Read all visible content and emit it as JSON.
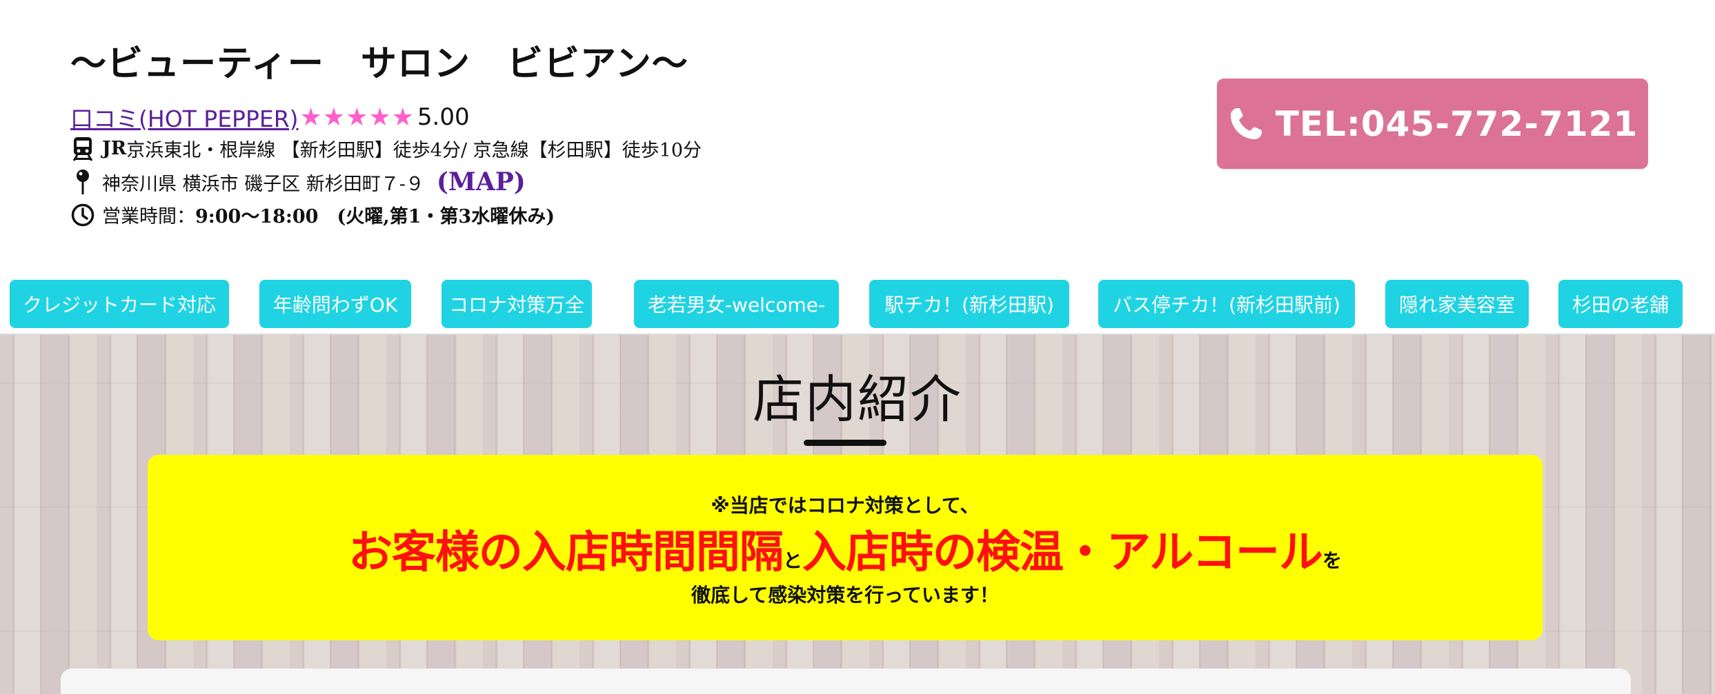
{
  "header": {
    "shop_title": "〜ビューティー　サロン　ビビアン〜",
    "reviews_link": "口コミ(HOT PEPPER)",
    "rating_stars": "★★★★★",
    "rating_score": "5.00",
    "access_prefix": "JR",
    "access_text": " 京浜東北・根岸線 【新杉田駅】徒歩4分/ 京急線【杉田駅】徒歩10分",
    "address_text": "神奈川県 横浜市 磯子区 新杉田町７-９",
    "map_link": "(MAP)",
    "hours_label": "営業時間：",
    "hours_time": "9:00〜18:00",
    "hours_closed": "　(火曜,第1・第3水曜休み)",
    "tel_label": "TEL:045-772-7121"
  },
  "tags": [
    "クレジットカード対応",
    "年齢問わずOK",
    "コロナ対策万全",
    "老若男女-welcome-",
    "駅チカ！(新杉田駅)",
    "バス停チカ！(新杉田駅前)",
    "隠れ家美容室",
    "杉田の老舗"
  ],
  "section": {
    "title": "店内紹介"
  },
  "notice": {
    "line1": "※当店ではコロナ対策として、",
    "line2_part1": "お客様の入店時間間隔",
    "line2_joiner": "と",
    "line2_part2": "入店時の検温・アルコール",
    "line2_tail": "を",
    "line3": "徹底して感染対策を行っています！"
  },
  "colors": {
    "tel_button": "#dc7296",
    "tag_bg": "#1fd3e3",
    "star": "#ff5fce",
    "link": "#5b1f9a",
    "notice_bg": "#ffff00",
    "notice_emphasis": "#ff1010"
  },
  "icons": {
    "access": "train-icon",
    "address": "map-pin-icon",
    "hours": "clock-icon",
    "tel": "phone-icon"
  }
}
